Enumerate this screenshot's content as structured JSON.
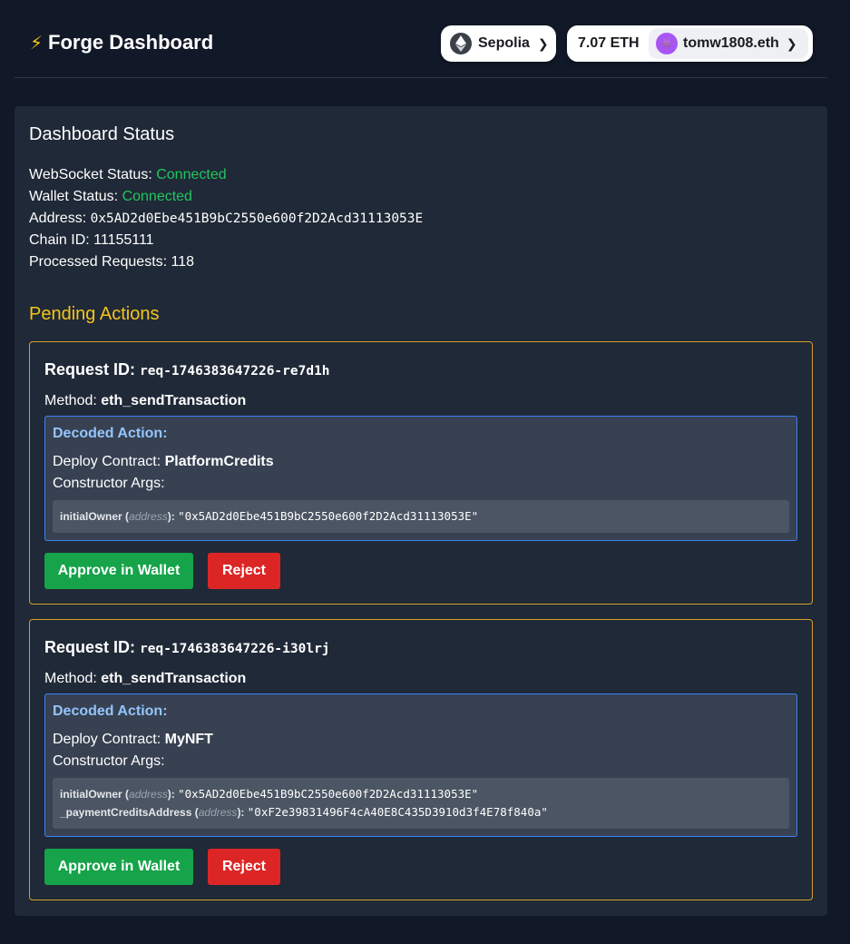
{
  "header": {
    "title": "Forge Dashboard",
    "network": "Sepolia",
    "balance": "7.07 ETH",
    "account": "tomw1808.eth"
  },
  "status": {
    "title": "Dashboard Status",
    "websocket_label": "WebSocket Status: ",
    "websocket_value": "Connected",
    "wallet_label": "Wallet Status: ",
    "wallet_value": "Connected",
    "address_label": "Address: ",
    "address_value": "0x5AD2d0Ebe451B9bC2550e600f2D2Acd31113053E",
    "chain_label": "Chain ID: ",
    "chain_value": "11155111",
    "processed_label": "Processed Requests: ",
    "processed_value": "118"
  },
  "pending": {
    "title": "Pending Actions",
    "labels": {
      "request_id": "Request ID: ",
      "method": "Method: ",
      "decoded": "Decoded Action:",
      "deploy": "Deploy Contract: ",
      "constructor": "Constructor Args:",
      "approve": "Approve in Wallet",
      "reject": "Reject"
    },
    "requests": [
      {
        "id": "req-1746383647226-re7d1h",
        "method": "eth_sendTransaction",
        "contract": "PlatformCredits",
        "args": [
          {
            "name": "initialOwner",
            "type": "address",
            "value": "\"0x5AD2d0Ebe451B9bC2550e600f2D2Acd31113053E\""
          }
        ]
      },
      {
        "id": "req-1746383647226-i30lrj",
        "method": "eth_sendTransaction",
        "contract": "MyNFT",
        "args": [
          {
            "name": "initialOwner",
            "type": "address",
            "value": "\"0x5AD2d0Ebe451B9bC2550e600f2D2Acd31113053E\""
          },
          {
            "name": "_paymentCreditsAddress",
            "type": "address",
            "value": "\"0xF2e39831496F4cA40E8C435D3910d3f4E78f840a\""
          }
        ]
      }
    ]
  }
}
